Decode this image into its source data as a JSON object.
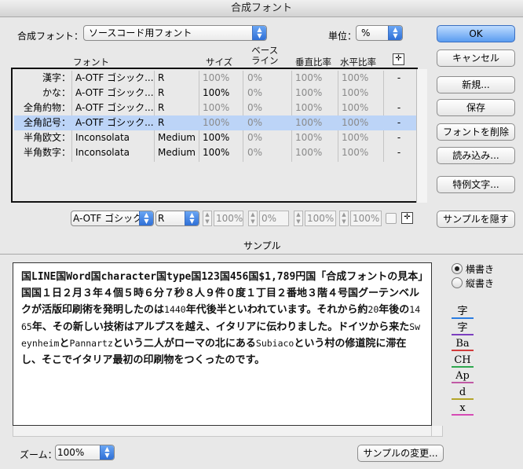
{
  "window": {
    "title": "合成フォント"
  },
  "composite_font": {
    "label": "合成フォント：",
    "value": "ソースコード用フォント"
  },
  "unit": {
    "label": "単位：",
    "value": "%"
  },
  "buttons": {
    "ok": "OK",
    "cancel": "キャンセル",
    "new": "新規...",
    "save": "保存",
    "delete_font": "フォントを削除",
    "load": "読み込み...",
    "exception": "特例文字...",
    "hide_sample": "サンプルを隠す",
    "change_sample": "サンプルの変更..."
  },
  "table": {
    "headers": {
      "font": "フォント",
      "size": "サイズ",
      "baseline": "ベース\nライン",
      "vscale": "垂直比率",
      "hscale": "水平比率"
    },
    "rows": [
      {
        "category": "漢字：",
        "font": "A-OTF ゴシック...",
        "style": "R",
        "size": "100%",
        "baseline": "0%",
        "vscale": "100%",
        "hscale": "100%",
        "mark": "-"
      },
      {
        "category": "かな：",
        "font": "A-OTF ゴシック...",
        "style": "R",
        "size": "100%",
        "baseline": "0%",
        "vscale": "100%",
        "hscale": "100%",
        "mark": ""
      },
      {
        "category": "全角約物：",
        "font": "A-OTF ゴシック...",
        "style": "R",
        "size": "100%",
        "baseline": "0%",
        "vscale": "100%",
        "hscale": "100%",
        "mark": "-"
      },
      {
        "category": "全角記号：",
        "font": "A-OTF ゴシック...",
        "style": "R",
        "size": "100%",
        "baseline": "0%",
        "vscale": "100%",
        "hscale": "100%",
        "mark": "-"
      },
      {
        "category": "半角欧文：",
        "font": "Inconsolata",
        "style": "Medium",
        "size": "100%",
        "baseline": "0%",
        "vscale": "100%",
        "hscale": "100%",
        "mark": "-"
      },
      {
        "category": "半角数字：",
        "font": "Inconsolata",
        "style": "Medium",
        "size": "100%",
        "baseline": "0%",
        "vscale": "100%",
        "hscale": "100%",
        "mark": "-"
      }
    ],
    "selected_index": 3
  },
  "editor": {
    "font": "A-OTF ゴシック",
    "style": "R",
    "size": "100%",
    "baseline": "0%",
    "vscale": "100%",
    "hscale": "100%"
  },
  "sample": {
    "label": "サンプル",
    "text_parts": [
      {
        "t": "国LINE国Word国character国type国123国456国$1,789円国「合成フォントの見本」国国１日２月３年４個５時６分７秒８人９件０度１丁目２番地３階４号国グーテンベルクが活版印刷術を発明したのは",
        "n": false
      },
      {
        "t": "1440",
        "n": true
      },
      {
        "t": "年代後半といわれています。それから約",
        "n": false
      },
      {
        "t": "20",
        "n": true
      },
      {
        "t": "年後の",
        "n": false
      },
      {
        "t": "1465",
        "n": true
      },
      {
        "t": "年、その新しい技術はアルプスを越え、イタリアに伝わりました。ドイツから来た",
        "n": false
      },
      {
        "t": "Sweynheim",
        "n": true
      },
      {
        "t": "と",
        "n": false
      },
      {
        "t": "Pannartz",
        "n": true
      },
      {
        "t": "という二人がローマの北にある",
        "n": false
      },
      {
        "t": "Subiaco",
        "n": true
      },
      {
        "t": "という村の修道院に滞在し、そこでイタリア最初の印刷物をつくったのです。",
        "n": false
      }
    ],
    "orientation": {
      "horizontal": "横書き",
      "vertical": "縦書き",
      "selected": "horizontal"
    },
    "guides": [
      {
        "glyph": "字",
        "color": "#2a7de1"
      },
      {
        "glyph": "字",
        "color": "#7c3fbf"
      },
      {
        "glyph": "Ba",
        "color": "#d23c3c"
      },
      {
        "glyph": "CH",
        "color": "#2fa84f"
      },
      {
        "glyph": "Ap",
        "color": "#c15aa5"
      },
      {
        "glyph": "d",
        "color": "#b4a52a"
      },
      {
        "glyph": "x",
        "color": "#d64bb5"
      }
    ]
  },
  "zoom": {
    "label": "ズーム：",
    "value": "100%"
  }
}
